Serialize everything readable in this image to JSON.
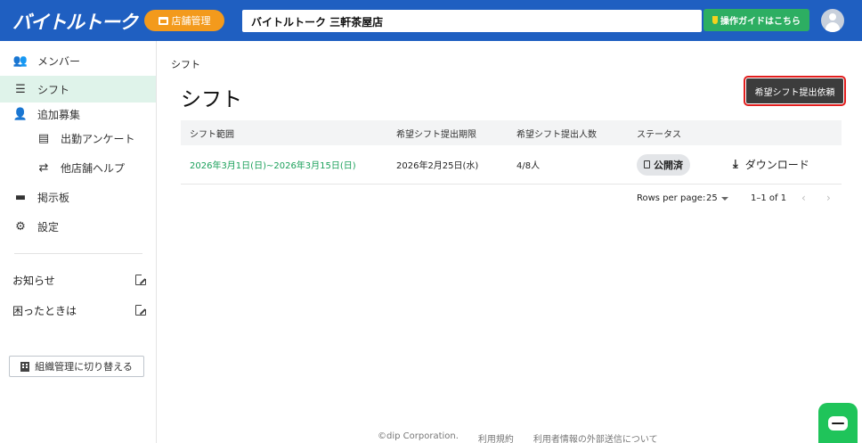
{
  "header": {
    "logo": "バイトルトーク",
    "store_button": "店舗管理",
    "store_name": "バイトルトーク 三軒茶屋店",
    "guide_button": "操作ガイドはこちら",
    "bg_color": "#1f5fc1",
    "store_btn_color": "#f39a1c",
    "guide_btn_color": "#2dae62"
  },
  "sidebar": {
    "items": [
      {
        "label": "メンバー",
        "icon": "members-icon"
      },
      {
        "label": "シフト",
        "icon": "list-icon",
        "active": true
      },
      {
        "label": "追加募集",
        "icon": "person-add-icon"
      },
      {
        "label": "出勤アンケート",
        "icon": "survey-icon",
        "sub": true
      },
      {
        "label": "他店舗ヘルプ",
        "icon": "swap-icon",
        "sub": true
      },
      {
        "label": "掲示板",
        "icon": "monitor-icon"
      },
      {
        "label": "設定",
        "icon": "gear-icon"
      }
    ],
    "links": [
      {
        "label": "お知らせ"
      },
      {
        "label": "困ったときは"
      }
    ],
    "org_button": "組織管理に切り替える"
  },
  "main": {
    "breadcrumb": "シフト",
    "title": "シフト",
    "request_button": "希望シフト提出依頼",
    "table": {
      "headers": [
        "シフト範囲",
        "希望シフト提出期限",
        "希望シフト提出人数",
        "ステータス"
      ],
      "rows": [
        {
          "range": "2026年3月1日(日)~2026年3月15日(日)",
          "deadline": "2026年2月25日(水)",
          "count": "4/8人",
          "status": "公開済",
          "action": "ダウンロード"
        }
      ]
    },
    "pagination": {
      "rows_per_page_label": "Rows per page:",
      "rows_per_page": "25",
      "range": "1–1 of 1",
      "prev": "‹",
      "next": "›"
    }
  },
  "footer": {
    "copyright": "©dip Corporation.",
    "terms": "利用規約",
    "external": "利用者情報の外部送信について"
  }
}
